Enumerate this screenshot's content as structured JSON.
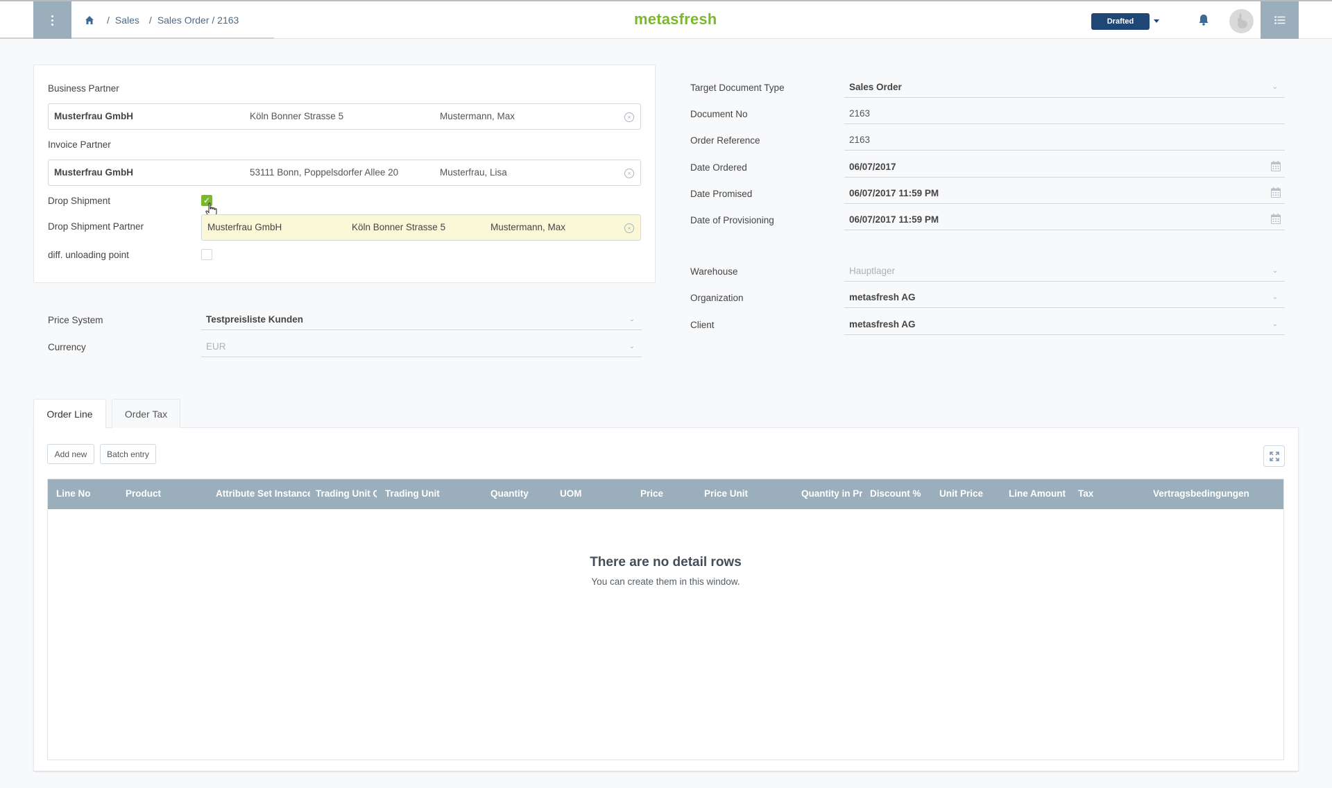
{
  "header": {
    "breadcrumb": [
      {
        "label": "Sales"
      },
      {
        "label": "Sales Order / 2163"
      }
    ],
    "separator": "/",
    "logo": "metasfresh",
    "status_label": "Drafted",
    "icons": {
      "menu": "vertical-dots-icon",
      "home": "home-icon",
      "status_dropdown": "caret-down-icon",
      "notifications": "bell-icon",
      "avatar": "rabbit-avatar-icon",
      "side_list": "list-icon"
    },
    "colors": {
      "menu_bg": "#9aaebb",
      "status_bg": "#1f4775",
      "logo": "#7cb82f"
    }
  },
  "left_panel": {
    "business_partner": {
      "label": "Business Partner",
      "name": "Musterfrau GmbH",
      "location": "Köln Bonner Strasse 5",
      "contact": "Mustermann, Max"
    },
    "invoice_partner": {
      "label": "Invoice Partner",
      "name": "Musterfrau GmbH",
      "location": "53111 Bonn, Poppelsdorfer Allee 20",
      "contact": "Musterfrau, Lisa"
    },
    "drop_shipment": {
      "label": "Drop Shipment",
      "checked": true,
      "check_glyph": "✓"
    },
    "drop_shipment_partner": {
      "label": "Drop Shipment Partner",
      "name": "Musterfrau GmbH",
      "location": "Köln Bonner Strasse 5",
      "contact": "Mustermann, Max"
    },
    "diff_unloading_point": {
      "label": "diff. unloading point",
      "checked": false
    },
    "clear_glyph": "×"
  },
  "pricing": {
    "price_system": {
      "label": "Price System",
      "value": "Testpreisliste Kunden"
    },
    "currency": {
      "label": "Currency",
      "value": "EUR"
    }
  },
  "right_panel": {
    "target_document_type": {
      "label": "Target Document Type",
      "value": "Sales Order"
    },
    "document_no": {
      "label": "Document No",
      "value": "2163"
    },
    "order_reference": {
      "label": "Order Reference",
      "value": "2163"
    },
    "date_ordered": {
      "label": "Date Ordered",
      "value": "06/07/2017"
    },
    "date_promised": {
      "label": "Date Promised",
      "value": "06/07/2017 11:59 PM"
    },
    "date_provisioning": {
      "label": "Date of Provisioning",
      "value": "06/07/2017 11:59 PM"
    },
    "warehouse": {
      "label": "Warehouse",
      "value": "Hauptlager"
    },
    "organization": {
      "label": "Organization",
      "value": "metasfresh AG"
    },
    "client": {
      "label": "Client",
      "value": "metasfresh AG"
    },
    "chevron_glyph": "⌄"
  },
  "tabs": [
    {
      "label": "Order Line",
      "active": true
    },
    {
      "label": "Order Tax",
      "active": false
    }
  ],
  "toolbar": {
    "add_new_label": "Add new",
    "batch_entry_label": "Batch entry"
  },
  "table": {
    "columns": [
      "Line No",
      "Product",
      "Attribute Set Instance",
      "Trading Unit Qty",
      "Trading Unit",
      "Quantity",
      "UOM",
      "Price",
      "Price Unit",
      "Quantity in Price UOM",
      "Discount %",
      "Unit Price",
      "Line Amount",
      "Tax",
      "Vertragsbedingungen"
    ],
    "rows": [],
    "empty_title": "There are no detail rows",
    "empty_subtitle": "You can create them in this window."
  }
}
